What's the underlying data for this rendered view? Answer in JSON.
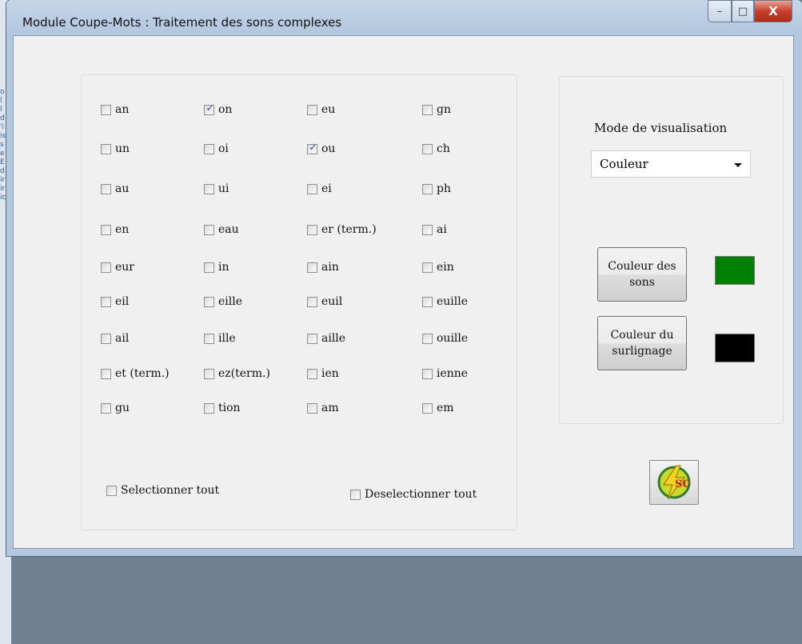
{
  "window": {
    "title": "Module Coupe-Mots : Traitement des sons complexes",
    "controls": {
      "minimize": "–",
      "maximize": "□",
      "close": "X"
    }
  },
  "background_strip": [
    "o",
    "l",
    "l",
    "d",
    "'i",
    "is",
    "s",
    "e",
    "E",
    "d",
    "ir",
    "ir",
    "ic"
  ],
  "sounds": [
    {
      "label": "an",
      "checked": false
    },
    {
      "label": "on",
      "checked": true
    },
    {
      "label": "eu",
      "checked": false
    },
    {
      "label": "gn",
      "checked": false
    },
    {
      "label": "un",
      "checked": false
    },
    {
      "label": "oi",
      "checked": false
    },
    {
      "label": "ou",
      "checked": true
    },
    {
      "label": "ch",
      "checked": false
    },
    {
      "label": "au",
      "checked": false
    },
    {
      "label": "ui",
      "checked": false
    },
    {
      "label": "ei",
      "checked": false
    },
    {
      "label": "ph",
      "checked": false
    },
    {
      "label": "en",
      "checked": false
    },
    {
      "label": "eau",
      "checked": false
    },
    {
      "label": "er (term.)",
      "checked": false
    },
    {
      "label": "ai",
      "checked": false
    },
    {
      "label": "eur",
      "checked": false
    },
    {
      "label": "in",
      "checked": false
    },
    {
      "label": "ain",
      "checked": false
    },
    {
      "label": "ein",
      "checked": false
    },
    {
      "label": "eil",
      "checked": false
    },
    {
      "label": "eille",
      "checked": false
    },
    {
      "label": "euil",
      "checked": false
    },
    {
      "label": "euille",
      "checked": false
    },
    {
      "label": "ail",
      "checked": false
    },
    {
      "label": "ille",
      "checked": false
    },
    {
      "label": "aille",
      "checked": false
    },
    {
      "label": "ouille",
      "checked": false
    },
    {
      "label": "et (term.)",
      "checked": false
    },
    {
      "label": "ez(term.)",
      "checked": false
    },
    {
      "label": "ien",
      "checked": false
    },
    {
      "label": "ienne",
      "checked": false
    },
    {
      "label": "gu",
      "checked": false
    },
    {
      "label": "tion",
      "checked": false
    },
    {
      "label": "am",
      "checked": false
    },
    {
      "label": "em",
      "checked": false
    }
  ],
  "select_all": {
    "label": "Selectionner tout",
    "checked": false
  },
  "deselect_all": {
    "label": "Deselectionner tout",
    "checked": false
  },
  "display_mode": {
    "label": "Mode de visualisation",
    "value": "Couleur"
  },
  "sound_color": {
    "label": "Couleur des sons",
    "color": "#008000"
  },
  "highlight_color": {
    "label": "Couleur du surlignage",
    "color": "#000000"
  },
  "action_icon": {
    "name": "lightning-sc-icon",
    "text": "SC"
  }
}
